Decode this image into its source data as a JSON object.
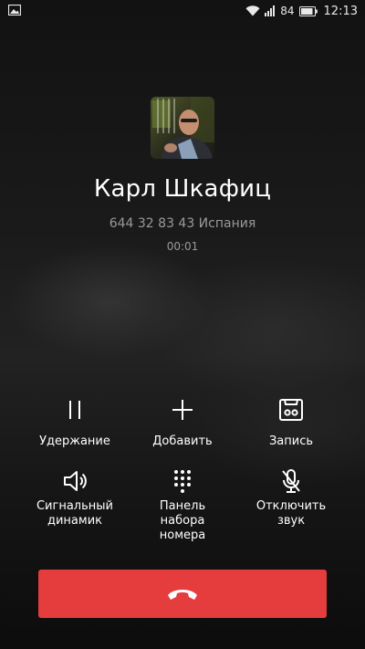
{
  "status_bar": {
    "battery_percent": "84",
    "time": "12:13",
    "icons": [
      "image-icon",
      "wifi-icon",
      "signal-icon",
      "battery-icon"
    ]
  },
  "contact": {
    "name": "Карл Шкафиц",
    "number_and_region": "644 32 83 43 Испания",
    "duration": "00:01"
  },
  "controls": {
    "hold": {
      "label": "Удержание",
      "icon": "pause-icon"
    },
    "add": {
      "label": "Добавить",
      "icon": "plus-icon"
    },
    "record": {
      "label": "Запись",
      "icon": "cassette-icon"
    },
    "speaker": {
      "label": "Сигнальный\nдинамик",
      "icon": "speaker-icon"
    },
    "keypad": {
      "label": "Панель\nнабора\nномера",
      "icon": "dialpad-icon"
    },
    "mute": {
      "label": "Отключить\nзвук",
      "icon": "mic-off-icon"
    }
  },
  "end_call": {
    "icon": "hang-up-icon",
    "color": "#e53d3d"
  }
}
